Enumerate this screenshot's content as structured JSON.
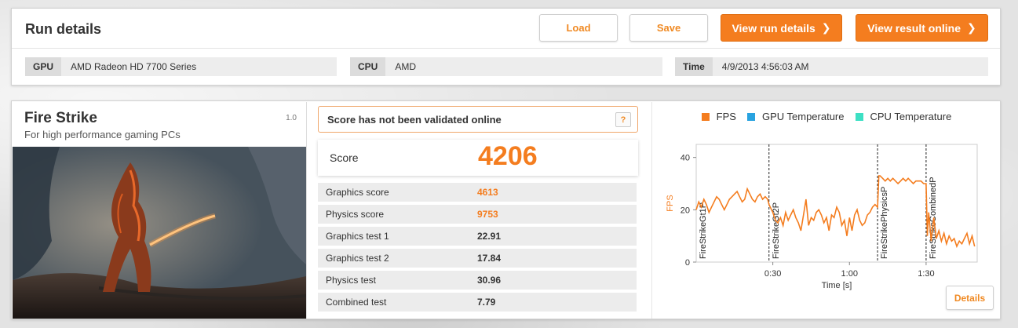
{
  "run": {
    "title": "Run details",
    "load_label": "Load",
    "save_label": "Save",
    "view_run_label": "View run details",
    "view_online_label": "View result online",
    "gpu_label": "GPU",
    "gpu_value": "AMD Radeon HD 7700 Series",
    "cpu_label": "CPU",
    "cpu_value": "AMD",
    "time_label": "Time",
    "time_value": "4/9/2013 4:56:03 AM"
  },
  "test": {
    "name": "Fire Strike",
    "subtitle": "For high performance gaming PCs",
    "version": "1.0"
  },
  "result": {
    "validation_text": "Score has not been validated online",
    "help_label": "?",
    "score_label": "Score",
    "score_value": "4206",
    "rows": [
      {
        "label": "Graphics score",
        "value": "4613",
        "highlight": true
      },
      {
        "label": "Physics score",
        "value": "9753",
        "highlight": true
      },
      {
        "label": "Graphics test 1",
        "value": "22.91",
        "highlight": false
      },
      {
        "label": "Graphics test 2",
        "value": "17.84",
        "highlight": false
      },
      {
        "label": "Physics test",
        "value": "30.96",
        "highlight": false
      },
      {
        "label": "Combined test",
        "value": "7.79",
        "highlight": false
      }
    ],
    "details_label": "Details"
  },
  "colors": {
    "accent": "#f47d1f",
    "fps": "#f47d1f",
    "gpu_temp": "#29a3e0",
    "cpu_temp": "#3de0c4"
  },
  "chart_data": {
    "type": "line",
    "legend": [
      {
        "name": "FPS",
        "color": "#f47d1f"
      },
      {
        "name": "GPU Temperature",
        "color": "#29a3e0"
      },
      {
        "name": "CPU Temperature",
        "color": "#3de0c4"
      }
    ],
    "xlabel": "Time [s]",
    "ylabel": "FPS",
    "xlim": [
      0,
      110
    ],
    "ylim": [
      0,
      45
    ],
    "xticks": [
      {
        "value": 30,
        "label": "0:30"
      },
      {
        "value": 60,
        "label": "1:00"
      },
      {
        "value": 90,
        "label": "1:30"
      }
    ],
    "yticks": [
      0,
      20,
      40
    ],
    "markers": [
      {
        "x": 0,
        "label": "FireStrikeGt1P"
      },
      {
        "x": 28.5,
        "label": "FireStrikeGt2P"
      },
      {
        "x": 71,
        "label": "FireStrikePhysicsP"
      },
      {
        "x": 90,
        "label": "FireStrikeCombinedP"
      }
    ],
    "series": [
      {
        "name": "FPS",
        "x": [
          0,
          1,
          2,
          3,
          4,
          5,
          6,
          7,
          8,
          9,
          10,
          11,
          12,
          13,
          14,
          15,
          16,
          17,
          18,
          19,
          20,
          21,
          22,
          23,
          24,
          25,
          26,
          27,
          28,
          28.5,
          29,
          30,
          31,
          32,
          33,
          34,
          35,
          36,
          37,
          38,
          39,
          40,
          41,
          42,
          43,
          44,
          45,
          46,
          47,
          48,
          49,
          50,
          51,
          52,
          53,
          54,
          55,
          56,
          57,
          58,
          59,
          60,
          61,
          62,
          63,
          64,
          65,
          66,
          67,
          68,
          69,
          70,
          71,
          71.5,
          72,
          73,
          74,
          75,
          76,
          77,
          78,
          79,
          80,
          81,
          82,
          83,
          84,
          85,
          86,
          87,
          88,
          89,
          90,
          90.5,
          91,
          92,
          93,
          94,
          95,
          96,
          97,
          98,
          99,
          100,
          101,
          102,
          103,
          104,
          105,
          106,
          107,
          108,
          109
        ],
        "y": [
          20,
          23,
          21,
          24,
          22,
          19,
          21,
          23,
          25,
          24,
          22,
          20,
          22,
          24,
          25,
          26,
          27,
          25,
          23,
          24,
          28,
          26,
          24,
          23,
          25,
          26,
          24,
          25,
          24,
          22,
          21,
          19,
          16,
          15,
          17,
          14,
          19,
          16,
          18,
          20,
          17,
          15,
          12,
          18,
          24,
          14,
          17,
          16,
          19,
          20,
          18,
          15,
          17,
          12,
          18,
          17,
          21,
          19,
          14,
          16,
          10,
          17,
          12,
          18,
          20,
          16,
          14,
          15,
          18,
          19,
          21,
          22,
          21,
          33,
          33,
          32,
          31,
          32,
          31,
          32,
          31,
          30,
          31,
          32,
          31,
          32,
          31,
          30,
          31,
          31,
          31,
          30,
          30,
          10,
          19,
          8,
          17,
          9,
          12,
          8,
          11,
          7,
          10,
          8,
          9,
          6,
          8,
          7,
          9,
          11,
          7,
          10,
          6
        ]
      }
    ]
  }
}
